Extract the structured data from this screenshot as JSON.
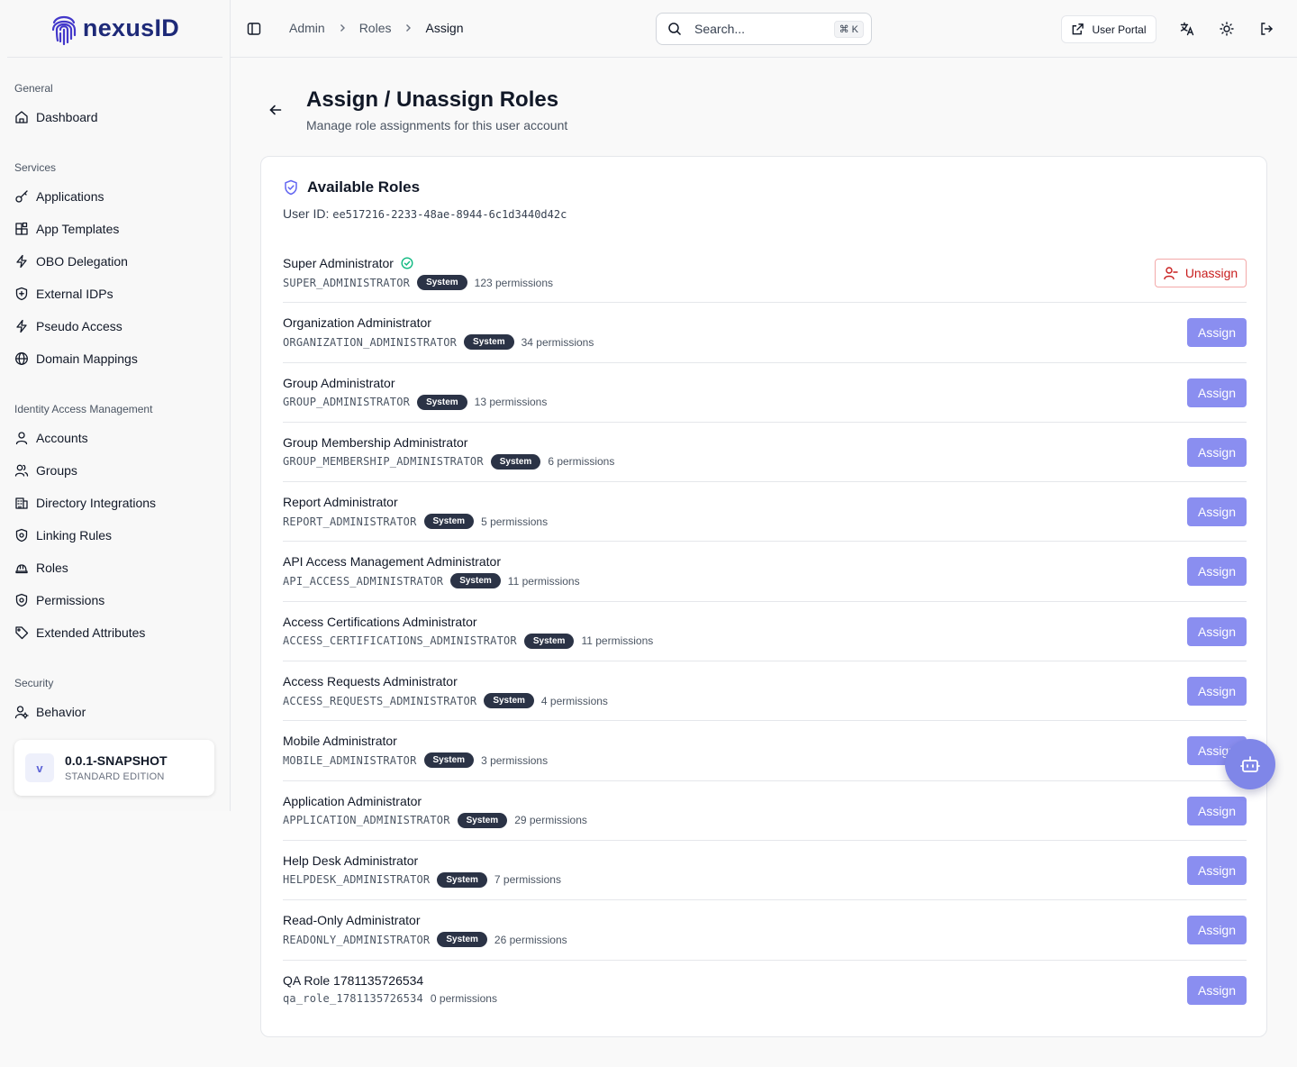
{
  "brand": {
    "name": "nexusID",
    "color": "#1e2a78",
    "accent": "#8a8ef0"
  },
  "sidebar": {
    "sections": [
      {
        "label": "General",
        "items": [
          {
            "label": "Dashboard",
            "icon": "home-icon"
          }
        ]
      },
      {
        "label": "Services",
        "items": [
          {
            "label": "Applications",
            "icon": "key-icon"
          },
          {
            "label": "App Templates",
            "icon": "blocks-icon"
          },
          {
            "label": "OBO Delegation",
            "icon": "zap-icon"
          },
          {
            "label": "External IDPs",
            "icon": "shield-plus-icon"
          },
          {
            "label": "Pseudo Access",
            "icon": "zap-icon"
          },
          {
            "label": "Domain Mappings",
            "icon": "globe-icon"
          }
        ]
      },
      {
        "label": "Identity Access Management",
        "items": [
          {
            "label": "Accounts",
            "icon": "user-icon"
          },
          {
            "label": "Groups",
            "icon": "users-icon"
          },
          {
            "label": "Directory Integrations",
            "icon": "building-icon"
          },
          {
            "label": "Linking Rules",
            "icon": "shield-cog-icon"
          },
          {
            "label": "Roles",
            "icon": "hard-hat-icon"
          },
          {
            "label": "Permissions",
            "icon": "shield-cog-icon"
          },
          {
            "label": "Extended Attributes",
            "icon": "tag-icon"
          }
        ]
      },
      {
        "label": "Security",
        "items": [
          {
            "label": "Behavior",
            "icon": "user-cog-icon"
          }
        ]
      }
    ],
    "version": {
      "badge": "v",
      "title": "0.0.1-SNAPSHOT",
      "edition": "STANDARD EDITION"
    }
  },
  "header": {
    "breadcrumb": [
      "Admin",
      "Roles",
      "Assign"
    ],
    "search_placeholder": "Search...",
    "search_shortcut": "⌘ K",
    "user_portal": "User Portal"
  },
  "page": {
    "title": "Assign / Unassign Roles",
    "subtitle": "Manage role assignments for this user account"
  },
  "card": {
    "title": "Available Roles",
    "user_id_label": "User ID:",
    "user_id": "ee517216-2233-48ae-8944-6c1d3440d42c",
    "system_label": "System",
    "assign_label": "Assign",
    "unassign_label": "Unassign",
    "roles": [
      {
        "name": "Super Administrator",
        "code": "SUPER_ADMINISTRATOR",
        "system": true,
        "permissions": "123 permissions",
        "assigned": true
      },
      {
        "name": "Organization Administrator",
        "code": "ORGANIZATION_ADMINISTRATOR",
        "system": true,
        "permissions": "34 permissions",
        "assigned": false
      },
      {
        "name": "Group Administrator",
        "code": "GROUP_ADMINISTRATOR",
        "system": true,
        "permissions": "13 permissions",
        "assigned": false
      },
      {
        "name": "Group Membership Administrator",
        "code": "GROUP_MEMBERSHIP_ADMINISTRATOR",
        "system": true,
        "permissions": "6 permissions",
        "assigned": false
      },
      {
        "name": "Report Administrator",
        "code": "REPORT_ADMINISTRATOR",
        "system": true,
        "permissions": "5 permissions",
        "assigned": false
      },
      {
        "name": "API Access Management Administrator",
        "code": "API_ACCESS_ADMINISTRATOR",
        "system": true,
        "permissions": "11 permissions",
        "assigned": false
      },
      {
        "name": "Access Certifications Administrator",
        "code": "ACCESS_CERTIFICATIONS_ADMINISTRATOR",
        "system": true,
        "permissions": "11 permissions",
        "assigned": false
      },
      {
        "name": "Access Requests Administrator",
        "code": "ACCESS_REQUESTS_ADMINISTRATOR",
        "system": true,
        "permissions": "4 permissions",
        "assigned": false
      },
      {
        "name": "Mobile Administrator",
        "code": "MOBILE_ADMINISTRATOR",
        "system": true,
        "permissions": "3 permissions",
        "assigned": false
      },
      {
        "name": "Application Administrator",
        "code": "APPLICATION_ADMINISTRATOR",
        "system": true,
        "permissions": "29 permissions",
        "assigned": false
      },
      {
        "name": "Help Desk Administrator",
        "code": "HELPDESK_ADMINISTRATOR",
        "system": true,
        "permissions": "7 permissions",
        "assigned": false
      },
      {
        "name": "Read-Only Administrator",
        "code": "READONLY_ADMINISTRATOR",
        "system": true,
        "permissions": "26 permissions",
        "assigned": false
      },
      {
        "name": "QA Role 1781135726534",
        "code": "qa_role_1781135726534",
        "system": false,
        "permissions": "0 permissions",
        "assigned": false
      }
    ]
  }
}
